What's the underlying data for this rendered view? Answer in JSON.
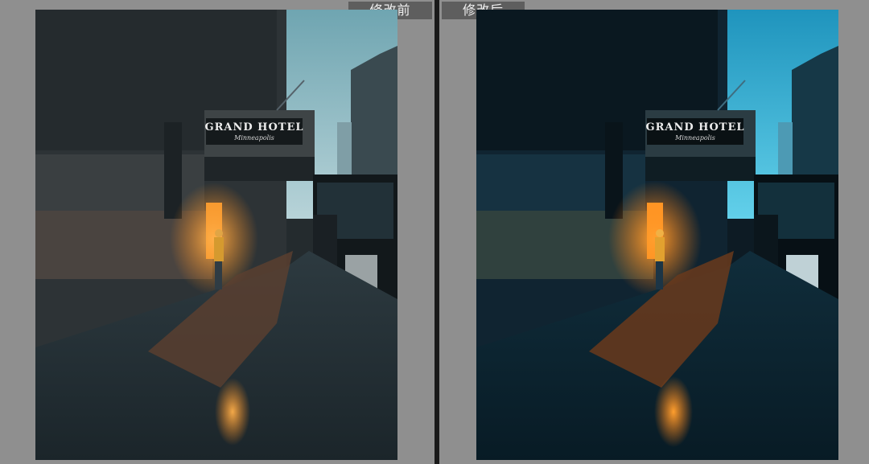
{
  "labels": {
    "before": "修改前",
    "after": "修改后"
  },
  "sign": {
    "name": "GRAND HOTEL",
    "city": "Minneapolis"
  },
  "colors": {
    "panel_bg": "#8f8f8f",
    "divider": "#1a1a1a",
    "label_bg": "#5e5e5e",
    "before_sky": "#8fbac4",
    "after_sky": "#2fb3d6",
    "warm_light": "#f0902a"
  }
}
